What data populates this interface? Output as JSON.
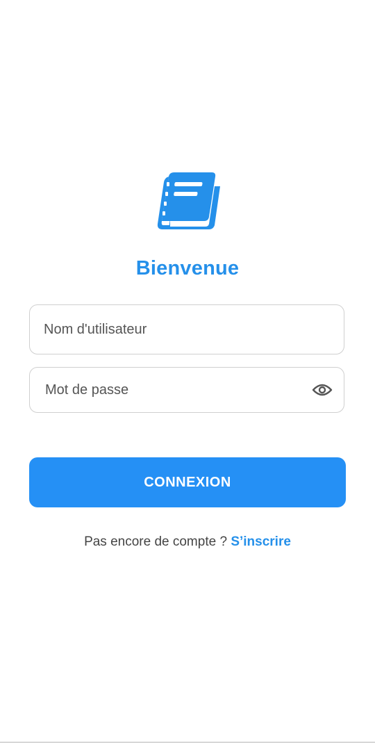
{
  "app": {
    "logo_icon": "book-icon",
    "accent_color": "#2590f5",
    "title": "Bienvenue"
  },
  "form": {
    "username_placeholder": "Nom d'utilisateur",
    "username_value": "",
    "password_placeholder": "Mot de passe",
    "password_value": "",
    "password_toggle_icon": "eye-icon",
    "submit_label": "CONNEXION"
  },
  "signup": {
    "prompt": "Pas encore de compte ?",
    "link_label": "S’inscrire"
  }
}
